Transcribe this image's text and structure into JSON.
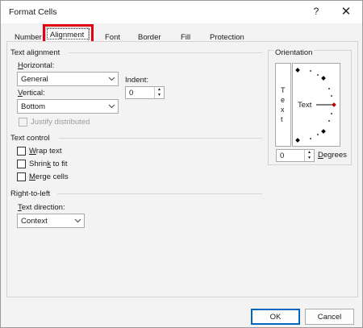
{
  "window": {
    "title": "Format Cells",
    "help": "?",
    "close": "✕"
  },
  "tabs": [
    {
      "label": "Number"
    },
    {
      "label": "Alignment",
      "selected": true
    },
    {
      "label": "Font"
    },
    {
      "label": "Border"
    },
    {
      "label": "Fill"
    },
    {
      "label": "Protection"
    }
  ],
  "text_alignment": {
    "title": "Text alignment",
    "horizontal": {
      "label_u": "H",
      "label_rest": "orizontal:",
      "value": "General"
    },
    "vertical": {
      "label_u": "V",
      "label_rest": "ertical:",
      "value": "Bottom"
    },
    "indent": {
      "label": "Indent:",
      "value": "0"
    },
    "justify_distributed": {
      "label": "Justify distributed",
      "checked": false,
      "disabled": true
    }
  },
  "text_control": {
    "title": "Text control",
    "wrap": {
      "u": "W",
      "rest": "rap text",
      "checked": false
    },
    "shrink": {
      "pre": "Shrin",
      "u": "k",
      "rest": " to fit",
      "checked": false
    },
    "merge": {
      "u": "M",
      "rest": "erge cells",
      "checked": false
    }
  },
  "rtl": {
    "title": "Right-to-left",
    "direction": {
      "label_u": "T",
      "label_rest": "ext direction:",
      "value": "Context"
    }
  },
  "orientation": {
    "title": "Orientation",
    "vertical_letters": [
      "T",
      "e",
      "x",
      "t"
    ],
    "dial_label": "Text",
    "degrees_value": "0",
    "degrees_label_u": "D",
    "degrees_label_rest": "egrees",
    "accent_color": "#c00000"
  },
  "buttons": {
    "ok": "OK",
    "cancel": "Cancel"
  },
  "colors": {
    "focus_ring": "#e3000f",
    "default_button": "#0067c0"
  }
}
